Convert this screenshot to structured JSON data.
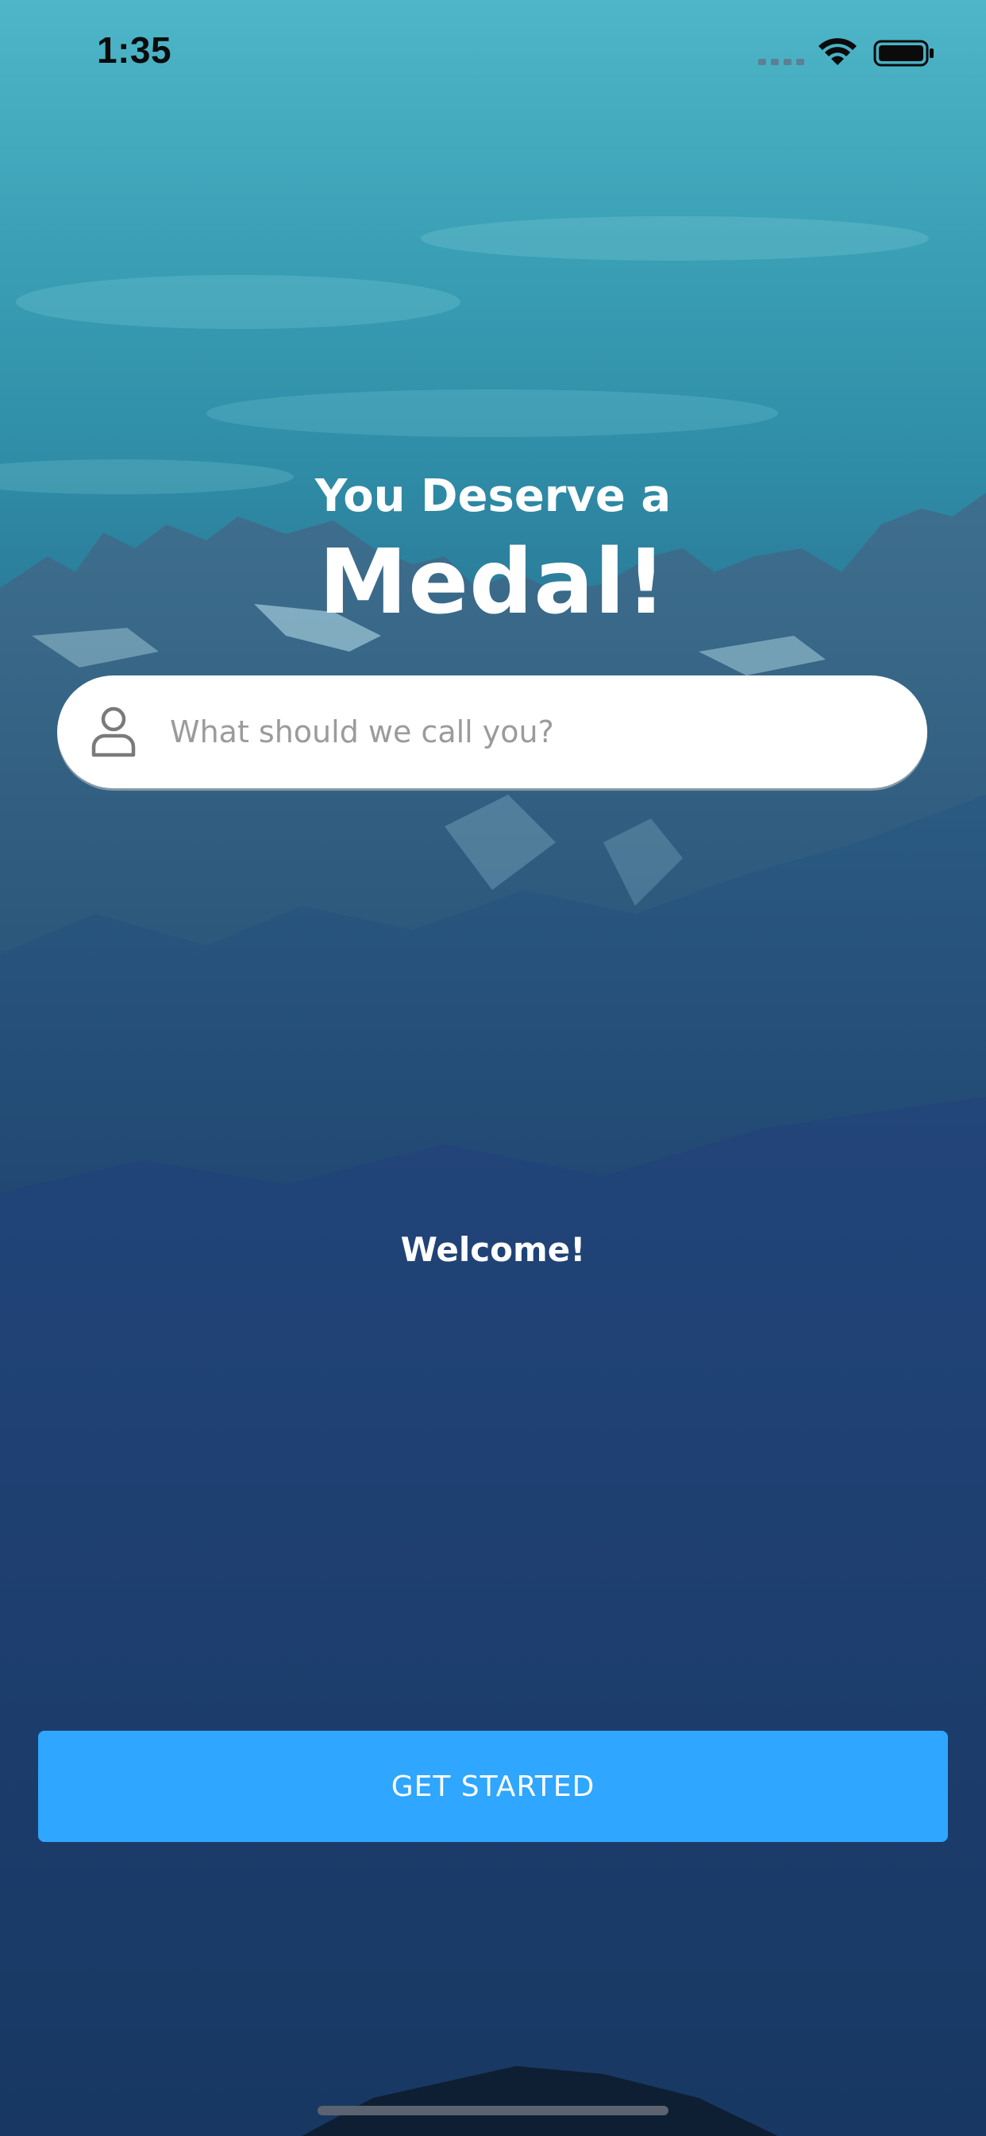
{
  "status_bar": {
    "time": "1:35"
  },
  "headline": {
    "line1": "You Deserve a",
    "line2": "Medal!"
  },
  "name_field": {
    "placeholder": "What should we call you?",
    "value": "",
    "icon": "user-icon"
  },
  "welcome_text": "Welcome!",
  "cta": {
    "label": "GET STARTED",
    "color": "#2fa6ff"
  }
}
